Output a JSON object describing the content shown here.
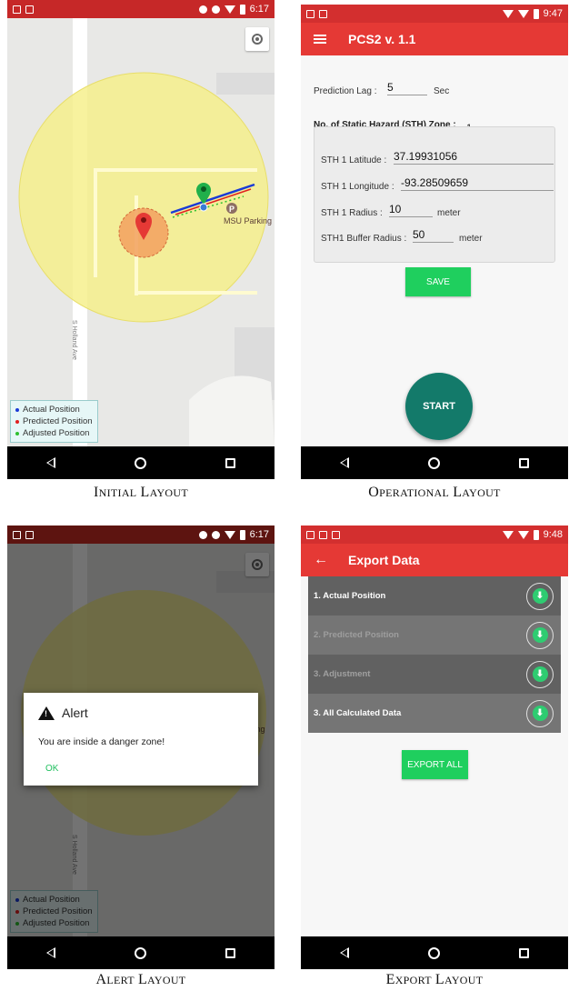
{
  "captions": {
    "initial": {
      "first": "I",
      "rest": "NITIAL",
      "word2_first": "L",
      "word2_rest": "AYOUT"
    },
    "operational": {
      "first": "O",
      "rest": "PERATIONAL",
      "word2_first": "L",
      "word2_rest": "AYOUT"
    },
    "alert": {
      "first": "A",
      "rest": "LERT",
      "word2_first": "L",
      "word2_rest": "AYOUT"
    },
    "export": {
      "first": "E",
      "rest": "XPORT",
      "word2_first": "L",
      "word2_rest": "AYOUT"
    }
  },
  "status": {
    "initial_time": "6:17",
    "operational_time": "9:47",
    "alert_time": "6:17",
    "export_time": "9:48",
    "colors": {
      "initial": "#c62828",
      "operational": "#d32f2f",
      "alert": "#5d1410",
      "export": "#d32f2f"
    }
  },
  "map": {
    "place_label": "MSU Parking",
    "street_label": "S Holland Ave",
    "legend": [
      {
        "label": "Actual Position",
        "color": "#1a3bd6"
      },
      {
        "label": "Predicted Position",
        "color": "#e02020"
      },
      {
        "label": "Adjusted Position",
        "color": "#2ec02e"
      }
    ]
  },
  "operational": {
    "title": "PCS2 v. 1.1",
    "prediction_lag_label": "Prediction Lag :",
    "prediction_lag_value": "5",
    "prediction_lag_unit": "Sec",
    "sth_zone_label": "No. of Static Hazard (STH) Zone :",
    "sth_zone_value": "1",
    "latitude_label": "STH 1 Latitude :",
    "latitude_value": "37.19931056",
    "longitude_label": "STH 1  Longitude :",
    "longitude_value": "-93.28509659",
    "radius_label": "STH 1  Radius :",
    "radius_value": "10",
    "radius_unit": "meter",
    "buffer_label": "STH1 Buffer Radius :",
    "buffer_value": "50",
    "buffer_unit": "meter",
    "save_label": "SAVE",
    "start_label": "START"
  },
  "alert": {
    "title": "Alert",
    "message": "You are inside a danger zone!",
    "ok_label": "OK"
  },
  "export": {
    "title": "Export Data",
    "rows": [
      {
        "label": "1. Actual Position"
      },
      {
        "label": "2. Predicted Position"
      },
      {
        "label": "3. Adjustment"
      },
      {
        "label": "3. All Calculated Data"
      }
    ],
    "export_all_label": "EXPORT ALL"
  }
}
